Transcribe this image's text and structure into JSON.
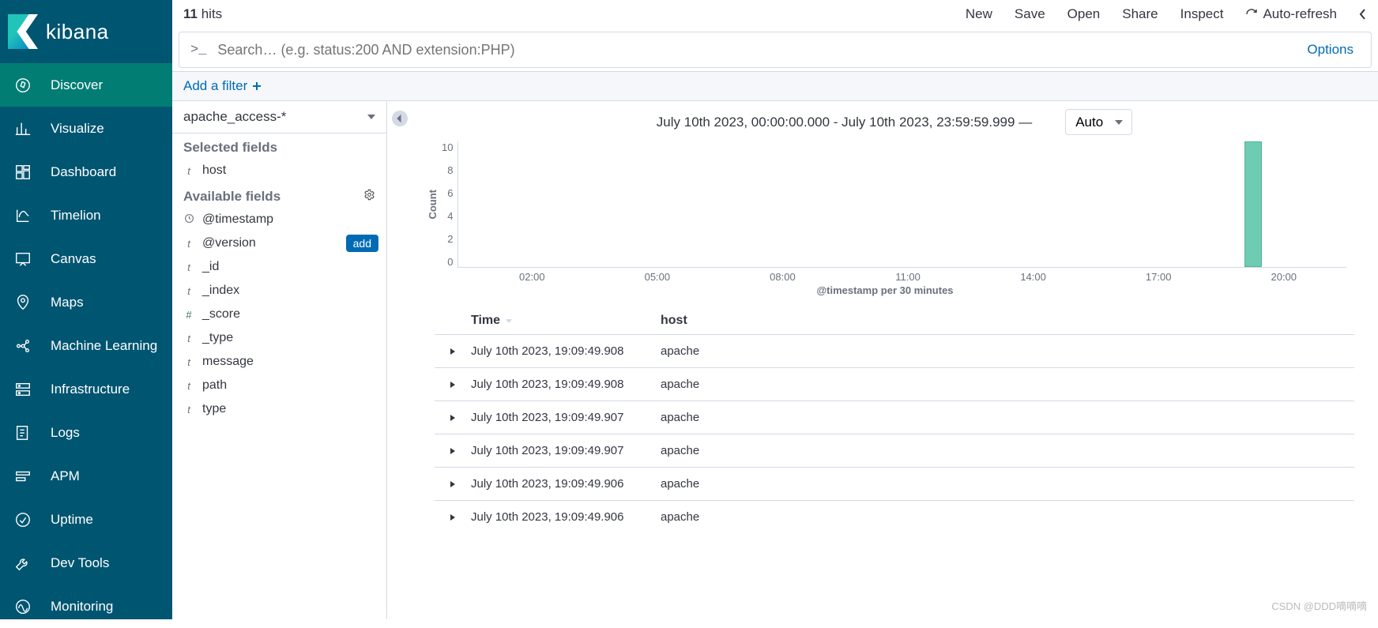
{
  "brand": "kibana",
  "nav": [
    {
      "label": "Discover",
      "icon": "compass",
      "active": true
    },
    {
      "label": "Visualize",
      "icon": "bar-chart"
    },
    {
      "label": "Dashboard",
      "icon": "dashboard"
    },
    {
      "label": "Timelion",
      "icon": "timelion"
    },
    {
      "label": "Canvas",
      "icon": "canvas"
    },
    {
      "label": "Maps",
      "icon": "map-pin"
    },
    {
      "label": "Machine Learning",
      "icon": "ml"
    },
    {
      "label": "Infrastructure",
      "icon": "infra"
    },
    {
      "label": "Logs",
      "icon": "logs"
    },
    {
      "label": "APM",
      "icon": "apm"
    },
    {
      "label": "Uptime",
      "icon": "uptime"
    },
    {
      "label": "Dev Tools",
      "icon": "wrench"
    },
    {
      "label": "Monitoring",
      "icon": "monitor"
    }
  ],
  "hits": {
    "count": "11",
    "label": "hits"
  },
  "top_links": {
    "new": "New",
    "save": "Save",
    "open": "Open",
    "share": "Share",
    "inspect": "Inspect",
    "auto_refresh": "Auto-refresh"
  },
  "search": {
    "prompt": ">_",
    "placeholder": "Search… (e.g. status:200 AND extension:PHP)",
    "options": "Options"
  },
  "filter": {
    "add": "Add a filter"
  },
  "index_pattern": "apache_access-*",
  "fields": {
    "selected_header": "Selected fields",
    "available_header": "Available fields",
    "selected": [
      {
        "type": "t",
        "name": "host"
      }
    ],
    "available": [
      {
        "type": "clock",
        "name": "@timestamp"
      },
      {
        "type": "t",
        "name": "@version",
        "add": true
      },
      {
        "type": "t",
        "name": "_id"
      },
      {
        "type": "t",
        "name": "_index"
      },
      {
        "type": "#",
        "name": "_score"
      },
      {
        "type": "t",
        "name": "_type"
      },
      {
        "type": "t",
        "name": "message"
      },
      {
        "type": "t",
        "name": "path"
      },
      {
        "type": "t",
        "name": "type"
      }
    ],
    "add_label": "add"
  },
  "time_range": "July 10th 2023, 00:00:00.000 - July 10th 2023, 23:59:59.999 —",
  "interval": "Auto",
  "chart_data": {
    "type": "bar",
    "ylabel": "Count",
    "xlabel": "@timestamp per 30 minutes",
    "y_ticks": [
      "10",
      "8",
      "6",
      "4",
      "2",
      "0"
    ],
    "x_ticks": [
      "02:00",
      "05:00",
      "08:00",
      "11:00",
      "14:00",
      "17:00",
      "20:00"
    ],
    "bars": [
      {
        "x_pct": 88.5,
        "height_pct": 100
      }
    ]
  },
  "table": {
    "columns": {
      "time": "Time",
      "host": "host"
    },
    "rows": [
      {
        "time": "July 10th 2023, 19:09:49.908",
        "host": "apache"
      },
      {
        "time": "July 10th 2023, 19:09:49.908",
        "host": "apache"
      },
      {
        "time": "July 10th 2023, 19:09:49.907",
        "host": "apache"
      },
      {
        "time": "July 10th 2023, 19:09:49.907",
        "host": "apache"
      },
      {
        "time": "July 10th 2023, 19:09:49.906",
        "host": "apache"
      },
      {
        "time": "July 10th 2023, 19:09:49.906",
        "host": "apache"
      }
    ]
  },
  "watermark": "CSDN @DDD嘀嘀嘀"
}
